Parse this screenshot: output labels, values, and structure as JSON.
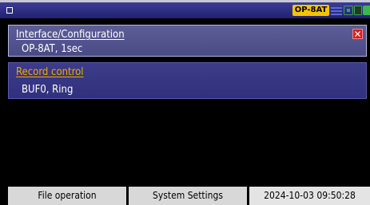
{
  "status_bar": {
    "badge": "OP-8AT",
    "icons": [
      "window-square-icon",
      "network-icon",
      "usb-icon",
      "sd-card-icon",
      "battery-icon"
    ],
    "badge_color": "#f5c400"
  },
  "panels": [
    {
      "title": "Interface/Configuration",
      "value": "OP-8AT, 1sec",
      "close": "✕"
    },
    {
      "title": "Record control",
      "value": "BUF0, Ring"
    }
  ],
  "footer": {
    "file_operation": "File operation",
    "system_settings": "System Settings",
    "datetime": "2024-10-03 09:50:28"
  }
}
